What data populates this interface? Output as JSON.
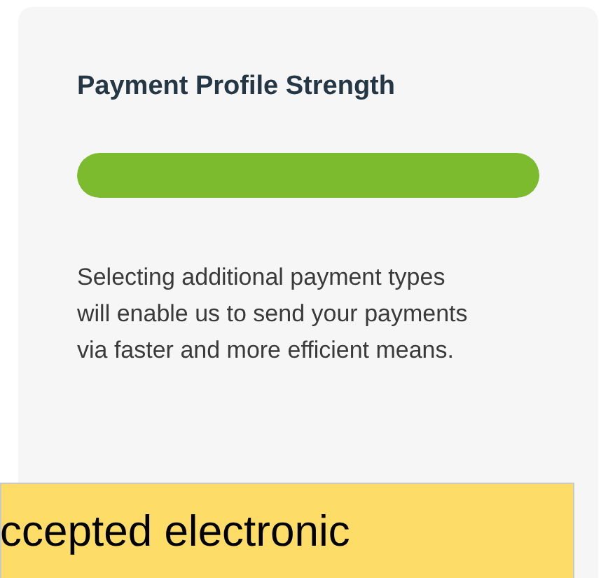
{
  "card": {
    "title": "Payment Profile Strength",
    "strength": {
      "level": 1
    },
    "description": "Selecting additional payment types will enable us to send your payments via faster and more efficient means."
  },
  "callout": {
    "text": "ccepted electronic"
  }
}
